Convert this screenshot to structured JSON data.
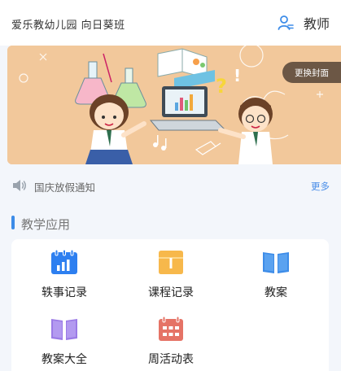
{
  "header": {
    "school_name": "爱乐教幼儿园 向日葵班",
    "role_icon": "user-switch-icon",
    "role_label": "教师"
  },
  "banner": {
    "change_cover_label": "更换封面"
  },
  "notice": {
    "icon": "speaker-icon",
    "text": "国庆放假通知",
    "more_label": "更多"
  },
  "section": {
    "title": "教学应用"
  },
  "apps": [
    {
      "label": "轶事记录",
      "icon": "chart-calendar-icon",
      "color": "#2d7ff0"
    },
    {
      "label": "课程记录",
      "icon": "folder-book-icon",
      "color": "#f7b84b"
    },
    {
      "label": "教案",
      "icon": "open-book-icon",
      "color": "#3d8ce8"
    },
    {
      "label": "教案大全",
      "icon": "open-book-purple-icon",
      "color": "#9b7be6"
    },
    {
      "label": "周活动表",
      "icon": "calendar-grid-icon",
      "color": "#e57366"
    }
  ],
  "colors": {
    "accent": "#3d8ce8",
    "banner_bg": "#f2c89b"
  }
}
